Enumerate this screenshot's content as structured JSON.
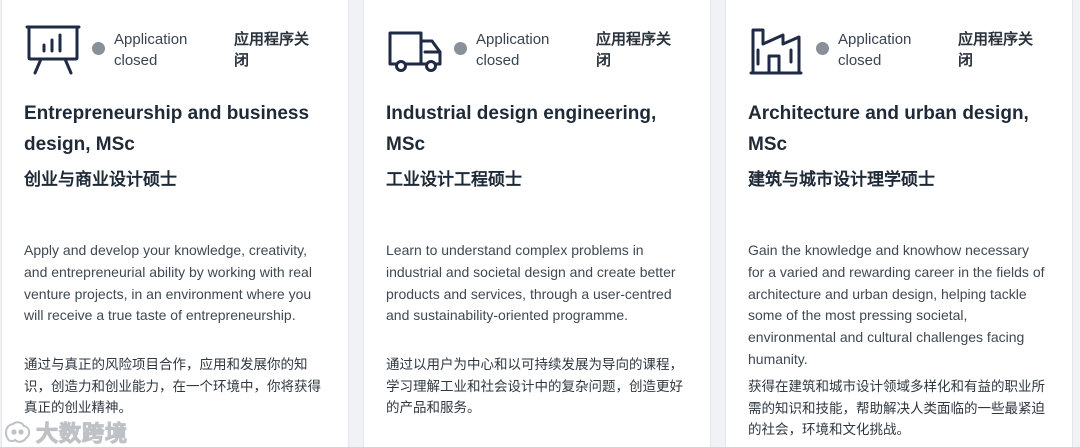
{
  "colors": {
    "icon": "#1f2a44",
    "status_dot": "#8a9099",
    "card_bg": "#ffffff",
    "page_bg": "#f0f2f5"
  },
  "cards": [
    {
      "icon": "presentation-chart-icon",
      "status_en": "Application closed",
      "status_zh": "应用程序关闭",
      "title_en": "Entrepreneurship and business design, MSc",
      "title_zh": "创业与商业设计硕士",
      "desc_en": "Apply and develop your knowledge, creativity, and entrepreneurial ability by working with real venture projects, in an environment where you will receive a true taste of entrepreneurship.",
      "desc_zh": "通过与真正的风险项目合作，应用和发展你的知识，创造力和创业能力，在一个环境中，你将获得真正的创业精神。"
    },
    {
      "icon": "truck-icon",
      "status_en": "Application closed",
      "status_zh": "应用程序关闭",
      "title_en": "Industrial design engineering, MSc",
      "title_zh": "工业设计工程硕士",
      "desc_en": "Learn to understand complex problems in industrial and societal design and create better products and services, through a user-centred and sustainability-oriented programme.",
      "desc_zh": "通过以用户为中心和以可持续发展为导向的课程，学习理解工业和社会设计中的复杂问题，创造更好的产品和服务。"
    },
    {
      "icon": "building-icon",
      "status_en": "Application closed",
      "status_zh": "应用程序关闭",
      "title_en": "Architecture and urban design, MSc",
      "title_zh": "建筑与城市设计理学硕士",
      "desc_en": "Gain the knowledge and knowhow necessary for a varied and rewarding career in the fields of architecture and urban design, helping tackle some of the most pressing societal, environmental and cultural challenges facing humanity.",
      "desc_zh": "获得在建筑和城市设计领域多样化和有益的职业所需的知识和技能，帮助解决人类面临的一些最紧迫的社会，环境和文化挑战。"
    }
  ],
  "watermark": {
    "text": "大数跨境"
  }
}
